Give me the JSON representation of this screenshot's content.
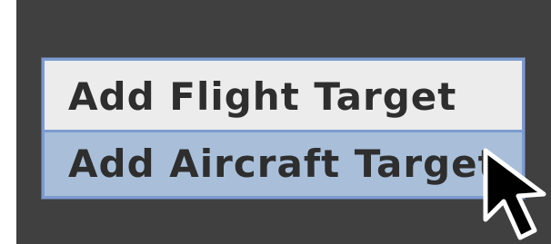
{
  "context_menu": {
    "items": [
      {
        "label": "Add Flight Target",
        "highlighted": false
      },
      {
        "label": "Add Aircraft Target",
        "highlighted": true
      }
    ]
  },
  "colors": {
    "background_dark": "#404040",
    "menu_background": "#ececec",
    "menu_highlight": "#a9bfd9",
    "menu_border": "#7d9bd0",
    "menu_text": "#2e2e2e"
  },
  "icons": {
    "pointer": "mouse-pointer-icon"
  }
}
